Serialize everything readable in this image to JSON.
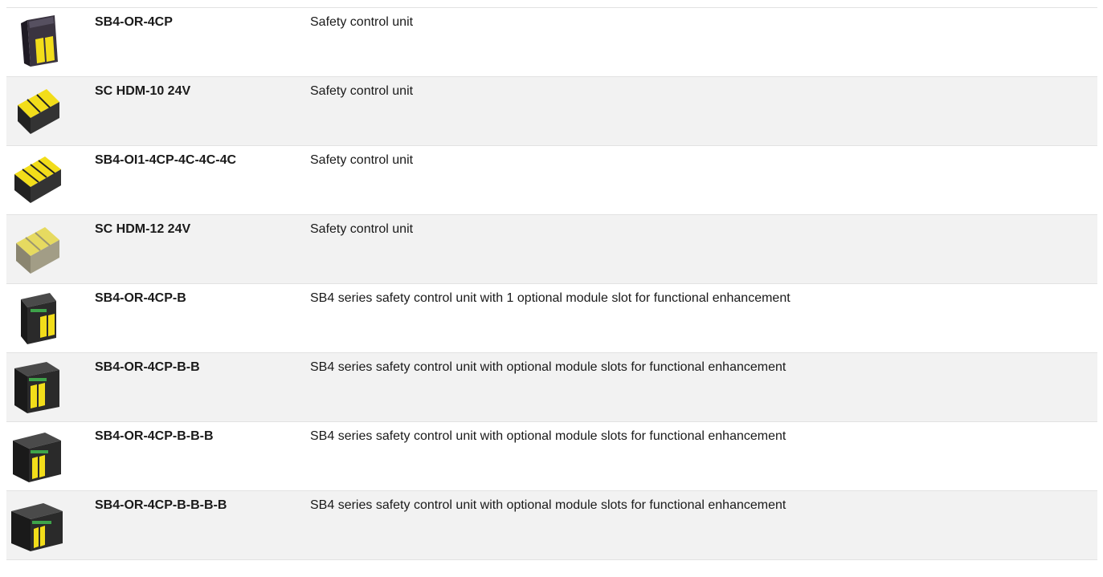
{
  "products": [
    {
      "name": "SB4-OR-4CP",
      "description": "Safety control unit",
      "image": "sb4-black-yellow-module-icon"
    },
    {
      "name": "SC HDM-10 24V",
      "description": "Safety control unit",
      "image": "sc-hdm-3slot-module-icon"
    },
    {
      "name": "SB4-OI1-4CP-4C-4C-4C",
      "description": "Safety control unit",
      "image": "sb4-4slot-module-icon"
    },
    {
      "name": "SC HDM-12 24V",
      "description": "Safety control unit",
      "image": "sc-hdm-grey-module-icon"
    },
    {
      "name": "SB4-OR-4CP-B",
      "description": "SB4 series safety control unit with 1 optional module slot for functional enhancement",
      "image": "sb4-b-module-icon"
    },
    {
      "name": "SB4-OR-4CP-B-B",
      "description": "SB4 series safety control unit with optional module slots for functional enhancement",
      "image": "sb4-bb-module-icon"
    },
    {
      "name": "SB4-OR-4CP-B-B-B",
      "description": "SB4 series safety control unit with optional module slots for functional enhancement",
      "image": "sb4-bbb-module-icon"
    },
    {
      "name": "SB4-OR-4CP-B-B-B-B",
      "description": "SB4 series safety control unit with optional module slots for functional enhancement",
      "image": "sb4-bbbb-module-icon"
    }
  ],
  "colors": {
    "row_alt": "#f2f2f2",
    "module_yellow": "#f2dd1a",
    "module_black": "#2a2a2a"
  }
}
